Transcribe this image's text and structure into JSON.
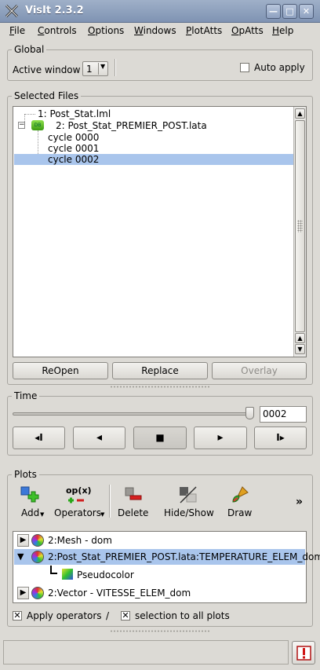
{
  "window": {
    "title": "VisIt 2.3.2",
    "min_glyph": "—",
    "max_glyph": "□",
    "close_glyph": "✕"
  },
  "menu": [
    {
      "label": "File",
      "mnemonic": "F",
      "rest": "ile"
    },
    {
      "label": "Controls",
      "mnemonic": "C",
      "rest": "ontrols"
    },
    {
      "label": "Options",
      "mnemonic": "O",
      "rest": "ptions"
    },
    {
      "label": "Windows",
      "mnemonic": "W",
      "rest": "indows"
    },
    {
      "label": "PlotAtts",
      "mnemonic": "P",
      "rest": "lotAtts"
    },
    {
      "label": "OpAtts",
      "mnemonic": "O",
      "rest": "pAtts"
    },
    {
      "label": "Help",
      "mnemonic": "H",
      "rest": "elp"
    }
  ],
  "global": {
    "title": "Global",
    "active_window_label": "Active window",
    "active_window_value": "1",
    "auto_apply_label": "Auto apply",
    "auto_apply_checked": false
  },
  "files": {
    "title": "Selected Files",
    "items": [
      {
        "text": "1: Post_Stat.lml",
        "selected": false
      },
      {
        "text": "2: Post_Stat_PREMIER_POST.lata",
        "selected": false
      },
      {
        "text": "cycle 0000",
        "selected": false
      },
      {
        "text": "cycle 0001",
        "selected": false
      },
      {
        "text": "cycle 0002",
        "selected": true
      }
    ],
    "collapse_glyph": "−",
    "db_icon_text": "DB",
    "buttons": {
      "reopen": "ReOpen",
      "replace": "Replace",
      "overlay": "Overlay"
    }
  },
  "time": {
    "title": "Time",
    "value": "0002",
    "slider_fraction": 1.0,
    "controls": {
      "back_step": "◂I",
      "play_back": "◂",
      "stop": "■",
      "play": "▸",
      "forward_step": "I▸"
    }
  },
  "plots": {
    "title": "Plots",
    "toolbar": {
      "add": "Add",
      "operators": "Operators",
      "operators_icon_text": "op(x)",
      "delete": "Delete",
      "hide_show": "Hide/Show",
      "draw": "Draw",
      "more": "»"
    },
    "items": [
      {
        "text": "2:Mesh - dom",
        "selected": false,
        "expanded": false
      },
      {
        "text": "2:Post_Stat_PREMIER_POST.lata:TEMPERATURE_ELEM_dom",
        "selected": true,
        "expanded": true
      },
      {
        "text": "Pseudocolor",
        "selected": false,
        "child": true
      },
      {
        "text": "2:Vector - VITESSE_ELEM_dom",
        "selected": false,
        "expanded": false
      }
    ],
    "apply_operators_label": "Apply operators",
    "separator": "/",
    "selection_label": "selection to all plots",
    "apply_operators_checked": true,
    "selection_checked": true
  },
  "status": {
    "text": ""
  },
  "colors": {
    "selection": "#a9c5ec",
    "title_bar": "#8fa2c1"
  }
}
